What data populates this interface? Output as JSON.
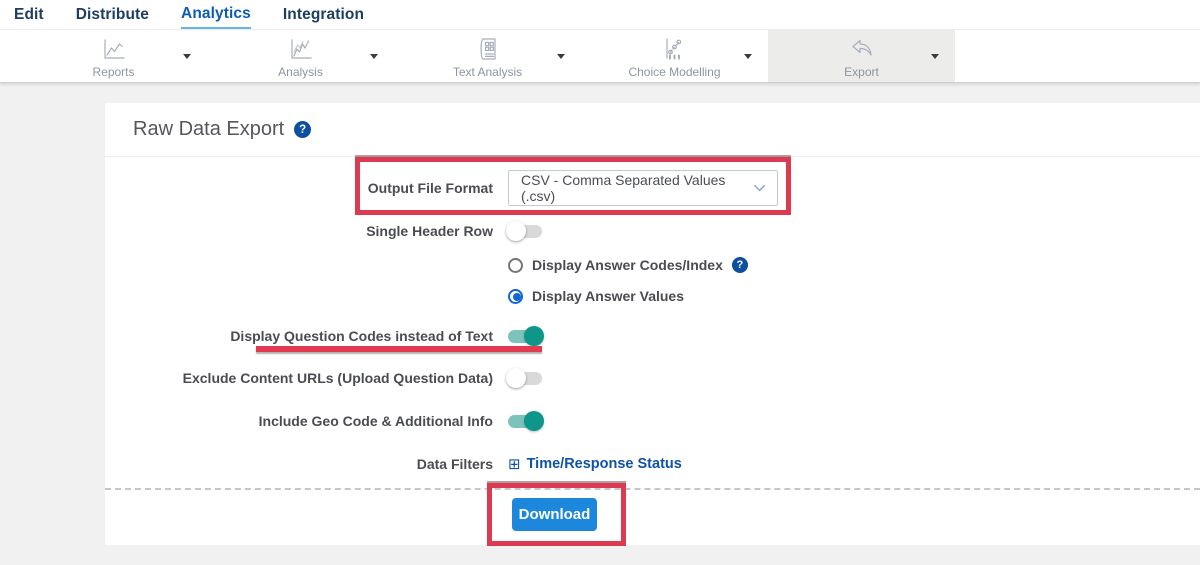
{
  "nav": {
    "items": [
      {
        "label": "Edit",
        "active": false
      },
      {
        "label": "Distribute",
        "active": false
      },
      {
        "label": "Analytics",
        "active": true
      },
      {
        "label": "Integration",
        "active": false
      }
    ]
  },
  "toolbar": {
    "items": [
      {
        "label": "Reports",
        "icon": "line-chart-icon",
        "selected": false
      },
      {
        "label": "Analysis",
        "icon": "multi-line-chart-icon",
        "selected": false
      },
      {
        "label": "Text Analysis",
        "icon": "document-grid-icon",
        "selected": false
      },
      {
        "label": "Choice Modelling",
        "icon": "scatter-chart-icon",
        "selected": false
      },
      {
        "label": "Export",
        "icon": "export-arrow-icon",
        "selected": true
      }
    ]
  },
  "page": {
    "title": "Raw Data Export"
  },
  "form": {
    "output_format": {
      "label": "Output File Format",
      "value": "CSV - Comma Separated Values (.csv)"
    },
    "single_header_row": {
      "label": "Single Header Row",
      "on": false
    },
    "answer_display": {
      "options": [
        {
          "label": "Display Answer Codes/Index",
          "selected": false,
          "has_help": true
        },
        {
          "label": "Display Answer Values",
          "selected": true,
          "has_help": false
        }
      ]
    },
    "question_codes": {
      "label": "Display Question Codes instead of Text",
      "on": true
    },
    "exclude_content_urls": {
      "label": "Exclude Content URLs (Upload Question Data)",
      "on": false
    },
    "include_geo": {
      "label": "Include Geo Code & Additional Info",
      "on": true
    },
    "data_filters": {
      "label": "Data Filters",
      "link_label": "Time/Response Status"
    },
    "download_label": "Download"
  },
  "icons": {
    "help_glyph": "?",
    "plus_box_glyph": "⊞"
  },
  "colors": {
    "annotation_red": "#dc3a50",
    "toggle_on": "#0e968a",
    "primary_blue": "#1d87dc",
    "link_blue": "#0f52a8",
    "nav_active_blue": "#0d5cb4"
  }
}
